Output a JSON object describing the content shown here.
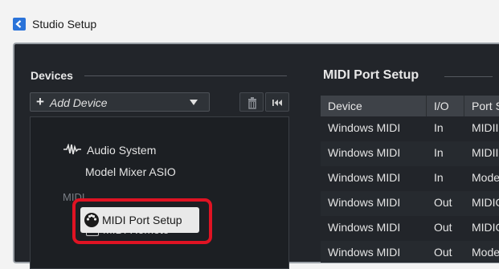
{
  "window": {
    "title": "Studio Setup"
  },
  "devices": {
    "title": "Devices",
    "add_device_label": "Add Device",
    "tree": {
      "audio_system": "Audio System",
      "mixer": "Model Mixer ASIO",
      "midi_group": "MIDI",
      "midi_port_setup": "MIDI Port Setup",
      "midi_remote": "MIDI Remote"
    }
  },
  "midi_port_setup": {
    "title": "MIDI Port Setup",
    "columns": [
      "Device",
      "I/O",
      "Port S"
    ],
    "rows": [
      {
        "device": "Windows MIDI",
        "io": "In",
        "port": "MIDII"
      },
      {
        "device": "Windows MIDI",
        "io": "In",
        "port": "MIDII"
      },
      {
        "device": "Windows MIDI",
        "io": "In",
        "port": "Mode"
      },
      {
        "device": "Windows MIDI",
        "io": "Out",
        "port": "MIDIO"
      },
      {
        "device": "Windows MIDI",
        "io": "Out",
        "port": "MIDIO"
      },
      {
        "device": "Windows MIDI",
        "io": "Out",
        "port": "Mode"
      }
    ]
  },
  "colors": {
    "accent_highlight": "#e01323",
    "panel_bg": "#22252a",
    "header_bg": "#3e4248"
  },
  "icons": [
    "app-icon",
    "plus-icon",
    "caret-down-icon",
    "trash-icon",
    "skip-first-icon",
    "audio-wave-icon",
    "midi-port-icon",
    "midi-remote-icon"
  ]
}
